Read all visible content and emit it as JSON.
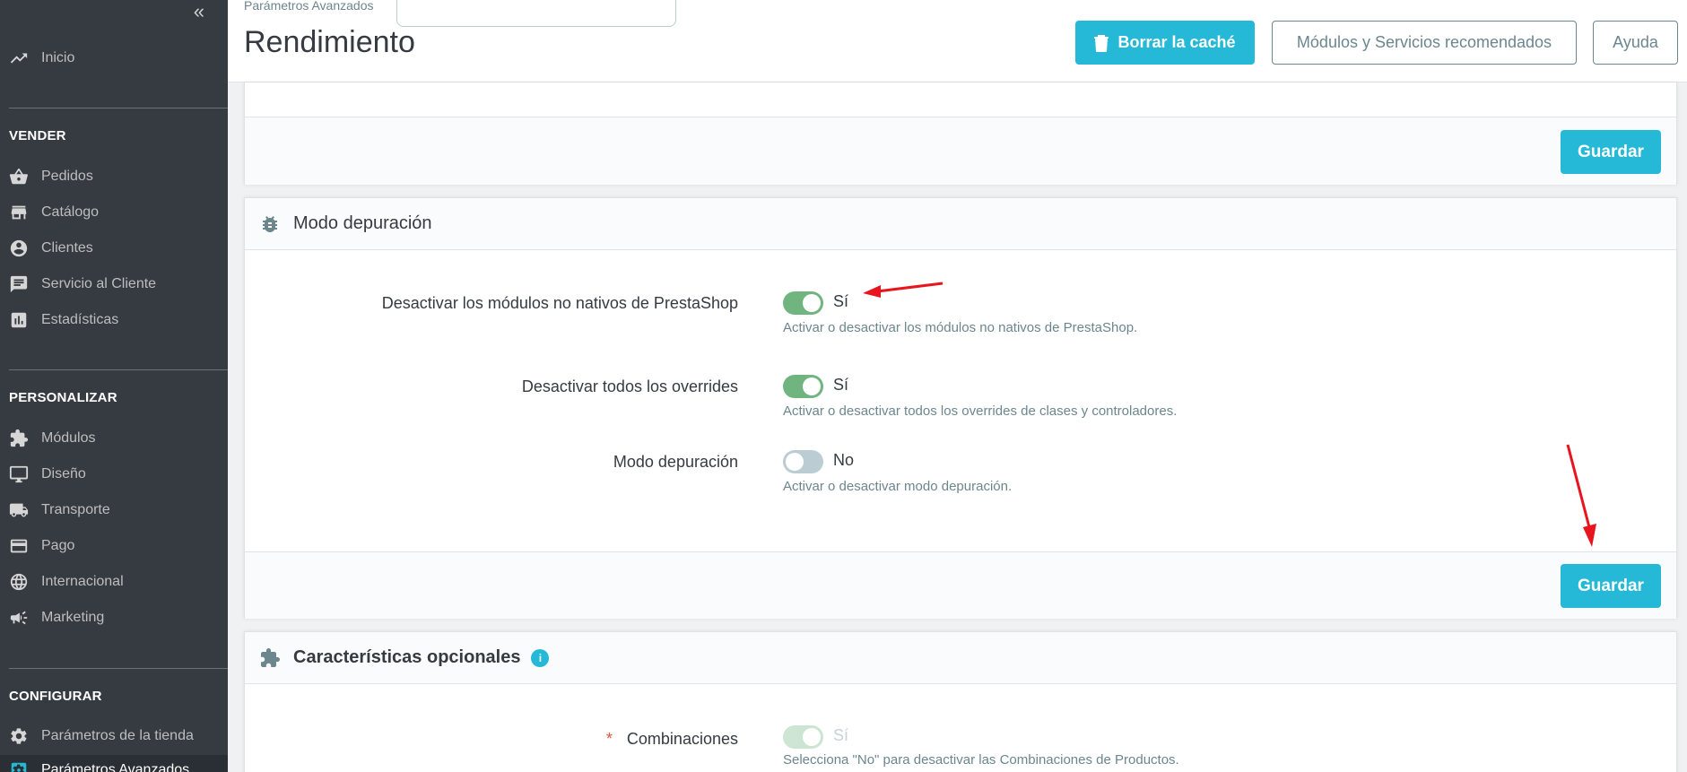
{
  "sidebar": {
    "collapse_glyph": "«",
    "home": {
      "label": "Inicio",
      "icon": "trending-up-icon"
    },
    "sections": {
      "sell": "VENDER",
      "customize": "PERSONALIZAR",
      "configure": "CONFIGURAR"
    },
    "sell_items": [
      {
        "label": "Pedidos",
        "icon": "basket-icon"
      },
      {
        "label": "Catálogo",
        "icon": "store-icon"
      },
      {
        "label": "Clientes",
        "icon": "account-circle-icon"
      },
      {
        "label": "Servicio al Cliente",
        "icon": "chat-icon"
      },
      {
        "label": "Estadísticas",
        "icon": "bar-chart-icon"
      }
    ],
    "customize_items": [
      {
        "label": "Módulos",
        "icon": "puzzle-icon"
      },
      {
        "label": "Diseño",
        "icon": "desktop-icon"
      },
      {
        "label": "Transporte",
        "icon": "truck-icon"
      },
      {
        "label": "Pago",
        "icon": "credit-card-icon"
      },
      {
        "label": "Internacional",
        "icon": "globe-icon"
      },
      {
        "label": "Marketing",
        "icon": "megaphone-icon"
      }
    ],
    "configure_items": [
      {
        "label": "Parámetros de la tienda",
        "icon": "settings-icon"
      },
      {
        "label": "Parámetros Avanzados",
        "icon": "settings-applications-icon"
      }
    ]
  },
  "header": {
    "breadcrumb": "Parámetros Avanzados",
    "title": "Rendimiento",
    "clear_cache_label": "Borrar la caché",
    "modules_label": "Módulos y Servicios recomendados",
    "help_label": "Ayuda"
  },
  "top_panel": {
    "save_label": "Guardar"
  },
  "debug_panel": {
    "title": "Modo depuración",
    "icon": "bug-icon",
    "rows": [
      {
        "label": "Desactivar los módulos no nativos de PrestaShop",
        "value": "Sí",
        "on": true,
        "help": "Activar o desactivar los módulos no nativos de PrestaShop."
      },
      {
        "label": "Desactivar todos los overrides",
        "value": "Sí",
        "on": true,
        "help": "Activar o desactivar todos los overrides de clases y controladores."
      },
      {
        "label": "Modo depuración",
        "value": "No",
        "on": false,
        "help": "Activar o desactivar modo depuración."
      }
    ],
    "save_label": "Guardar"
  },
  "optional_panel": {
    "title": "Características opcionales",
    "icon": "puzzle-icon",
    "info_glyph": "i",
    "rows": [
      {
        "required_mark": "*",
        "label": "Combinaciones",
        "value": "Sí",
        "on": true,
        "disabled": true,
        "help": "Selecciona \"No\" para desactivar las Combinaciones de Productos."
      }
    ]
  },
  "colors": {
    "primary": "#25b9d7",
    "sidebar_bg": "#363a41",
    "toggle_on": "#70b580",
    "toggle_off": "#bbcdd2",
    "annotation_arrow": "#e8141e"
  }
}
